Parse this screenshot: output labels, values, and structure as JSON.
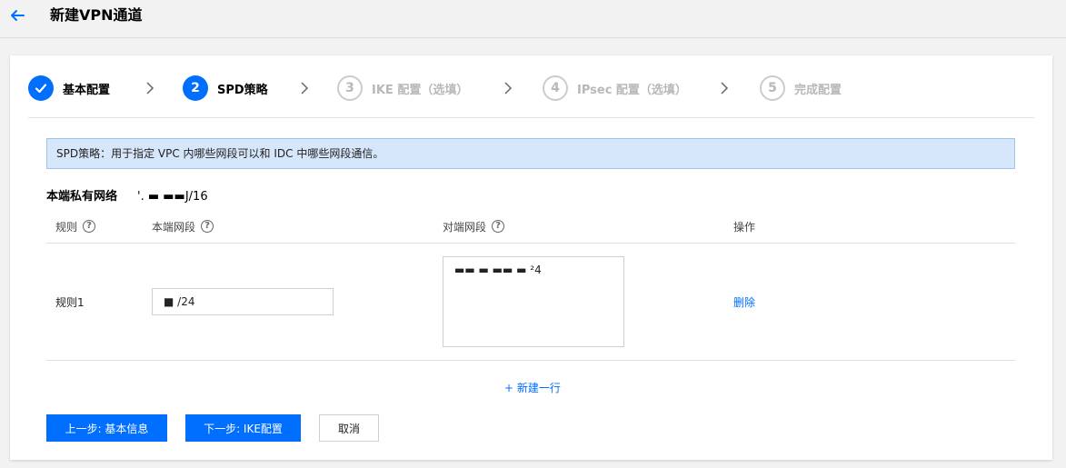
{
  "header": {
    "title": "新建VPN通道"
  },
  "steps": [
    {
      "number": "1",
      "label": "基本配置",
      "state": "done"
    },
    {
      "number": "2",
      "label": "SPD策略",
      "state": "active"
    },
    {
      "number": "3",
      "label": "IKE 配置（选填）",
      "state": "pending"
    },
    {
      "number": "4",
      "label": "IPsec 配置（选填）",
      "state": "pending"
    },
    {
      "number": "5",
      "label": "完成配置",
      "state": "pending"
    }
  ],
  "notice": "SPD策略：用于指定 VPC 内哪些网段可以和 IDC 中哪些网段通信。",
  "vpc": {
    "label": "本端私有网络",
    "value": "'. ▬  ▬▬J/16"
  },
  "table": {
    "headers": {
      "rule": "规则",
      "local": "本端网段",
      "remote": "对端网段",
      "action": "操作"
    },
    "rows": [
      {
        "name": "规则1",
        "local_value": "■      /24",
        "remote_value": "▬▬ ▬  ▬▬ ▬ ²4",
        "action": "删除"
      }
    ]
  },
  "add_row": "+ 新建一行",
  "buttons": {
    "prev": "上一步: 基本信息",
    "next": "下一步: IKE配置",
    "cancel": "取消"
  },
  "colors": {
    "accent": "#006eff",
    "notice_bg": "#d6e7fb",
    "pending": "#b8b8b8"
  }
}
